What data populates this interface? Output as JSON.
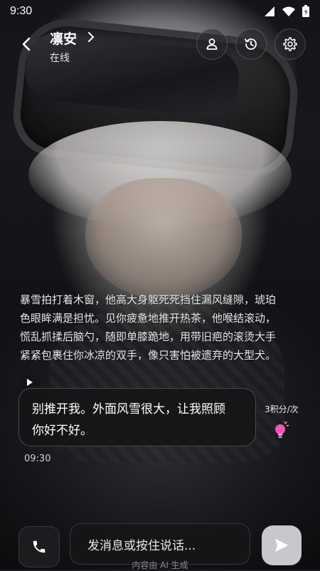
{
  "status_bar": {
    "time": "9:30"
  },
  "header": {
    "title": "凛安",
    "status": "在线"
  },
  "narration": [
    "暴雪拍打着木窗，他高大身躯死死挡住漏风缝隙，琥珀",
    "色眼眸满是担忧。见你疲惫地推开热茶，他喉结滚动，",
    "慌乱抓揉后脑勺，随即单膝跪地，用带旧疤的滚烫大手",
    "紧紧包裹住你冰凉的双手，像只害怕被遗弃的大型犬。"
  ],
  "message": {
    "lines": [
      "别推开我。外面风雪很大，让我照顾",
      "你好不好。"
    ],
    "time": "09:30",
    "cost": "3积分/次"
  },
  "input": {
    "placeholder": "发消息或按住说话..."
  },
  "disclaimer": "内容由 AI 生成",
  "icons": {
    "back": "chevron-left-icon",
    "profile": "person-icon",
    "history": "history-icon",
    "settings": "gear-icon",
    "call": "phone-icon",
    "send": "send-icon",
    "play": "play-icon",
    "bulb": "lightbulb-icon"
  },
  "colors": {
    "accent": "#e94fa8",
    "send_bg": "#c9c7cd"
  }
}
